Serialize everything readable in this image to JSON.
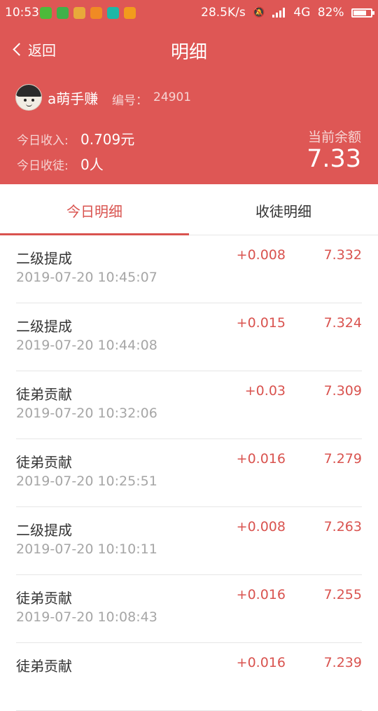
{
  "status_bar": {
    "time": "10:53",
    "net_speed": "28.5K/s",
    "network_type": "4G",
    "battery": "82%",
    "battery_level": 0.82,
    "app_icon_colors": [
      "#4cba3a",
      "#3fb04a",
      "#e8a93a",
      "#f08a24",
      "#1eb7a6",
      "#f29b1d"
    ]
  },
  "header": {
    "back_label": "返回",
    "title": "明细"
  },
  "user": {
    "name": "a萌手赚",
    "id_label": "编号：",
    "id": "24901"
  },
  "stats": {
    "today_income_label": "今日收入:",
    "today_income": "0.709元",
    "today_recruits_label": "今日收徒:",
    "today_recruits": "0人",
    "balance_label": "当前余额",
    "balance": "7.33"
  },
  "tabs": [
    {
      "label": "今日明细",
      "active": true
    },
    {
      "label": "收徒明细",
      "active": false
    }
  ],
  "colors": {
    "header_bg": "#de5755",
    "accent": "#d9534f"
  },
  "records": [
    {
      "type": "二级提成",
      "time": "2019-07-20 10:45:07",
      "amount": "+0.008",
      "balance": "7.332"
    },
    {
      "type": "二级提成",
      "time": "2019-07-20 10:44:08",
      "amount": "+0.015",
      "balance": "7.324"
    },
    {
      "type": "徒弟贡献",
      "time": "2019-07-20 10:32:06",
      "amount": "+0.03",
      "balance": "7.309"
    },
    {
      "type": "徒弟贡献",
      "time": "2019-07-20 10:25:51",
      "amount": "+0.016",
      "balance": "7.279"
    },
    {
      "type": "二级提成",
      "time": "2019-07-20 10:10:11",
      "amount": "+0.008",
      "balance": "7.263"
    },
    {
      "type": "徒弟贡献",
      "time": "2019-07-20 10:08:43",
      "amount": "+0.016",
      "balance": "7.255"
    },
    {
      "type": "徒弟贡献",
      "time": "",
      "amount": "+0.016",
      "balance": "7.239"
    }
  ]
}
